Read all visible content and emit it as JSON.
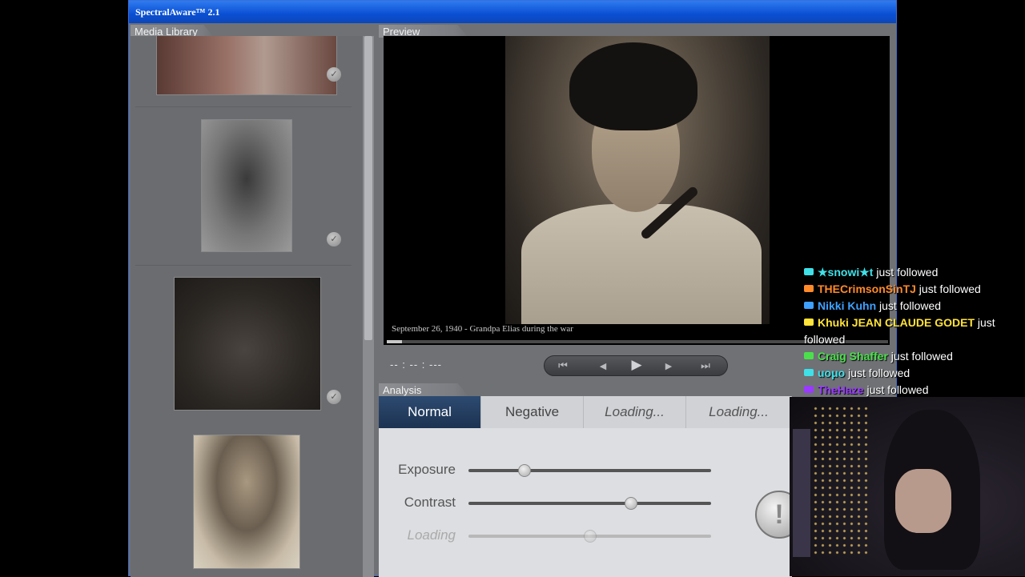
{
  "window": {
    "title": "SpectralAware™ 2.1"
  },
  "library": {
    "tab_label": "Media Library",
    "items": [
      {
        "name": "photo-woman-cropped",
        "checked": true
      },
      {
        "name": "photo-family-portrait",
        "checked": true
      },
      {
        "name": "photo-woman-seated-field",
        "checked": true
      },
      {
        "name": "photo-man-with-pipe",
        "checked": false
      }
    ]
  },
  "preview": {
    "tab_label": "Preview",
    "caption": "September 26, 1940 - Grandpa Elias during the war",
    "progress_fraction": 0.03,
    "timecode": "-- : -- : ---"
  },
  "transport": {
    "skip_back": "⏮",
    "step_back": "◀",
    "play": "▶",
    "step_forward": "▶",
    "skip_forward": "⏭"
  },
  "analysis": {
    "tab_label": "Analysis",
    "tabs": [
      "Normal",
      "Negative",
      "Loading...",
      "Loading..."
    ],
    "active_tab": 0,
    "sliders": [
      {
        "label": "Exposure",
        "value": 0.23
      },
      {
        "label": "Contrast",
        "value": 0.67
      },
      {
        "label": "Loading",
        "value": 0.5
      }
    ],
    "alert_symbol": "!"
  },
  "overlay": {
    "follow_suffix": "just followed",
    "followers": [
      {
        "name": "★snowi★t",
        "color": "#3fe0e8"
      },
      {
        "name": "THECrimsonSinTJ",
        "color": "#ff8a2a"
      },
      {
        "name": "Nikki Kuhn",
        "color": "#3fa0ff"
      },
      {
        "name": "Khuki JEAN CLAUDE GODET",
        "color": "#ffe23a"
      },
      {
        "name": "Craig Shaffer",
        "color": "#4be04b"
      },
      {
        "name": "uoμo",
        "color": "#3fe0e8"
      },
      {
        "name": "TheHaze",
        "color": "#9a3aff"
      }
    ]
  }
}
